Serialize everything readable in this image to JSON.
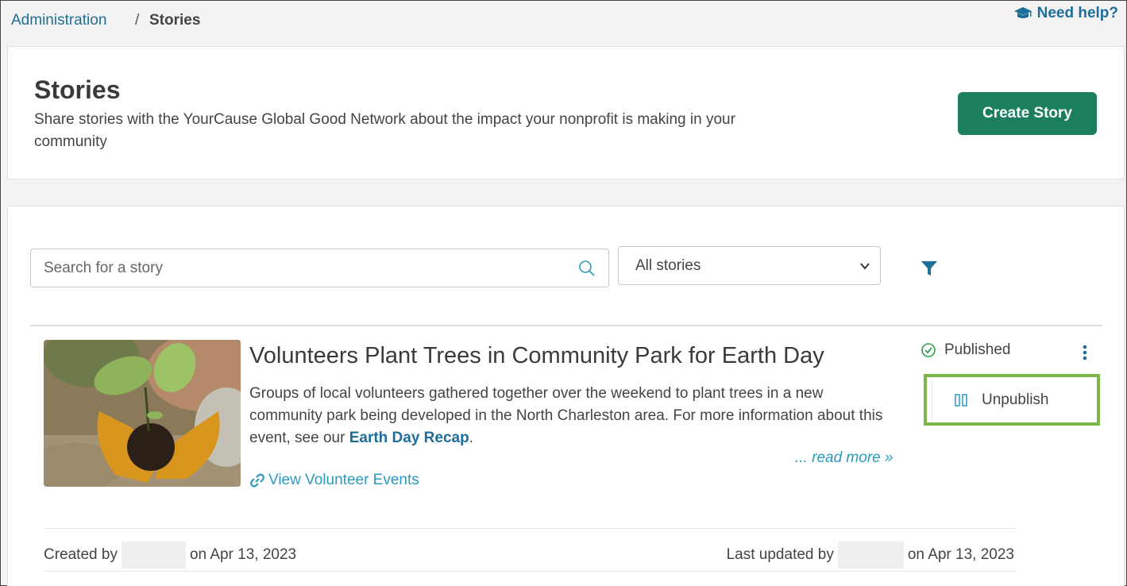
{
  "breadcrumb": {
    "parent": "Administration",
    "separator": "/",
    "current": "Stories"
  },
  "help": {
    "label": "Need help?",
    "icon": "graduation-cap-icon"
  },
  "header": {
    "title": "Stories",
    "description": "Share stories with the YourCause Global Good Network about the impact your nonprofit is making in your community",
    "create_button": "Create Story"
  },
  "toolbar": {
    "search_placeholder": "Search for a story",
    "filter_select_value": "All stories"
  },
  "story": {
    "title": "Volunteers Plant Trees in Community Park for Earth Day",
    "body_text": "Groups of local volunteers gathered together over the weekend to plant trees in a new community park being developed in the North Charleston area. For more information about this event, see our ",
    "body_link": "Earth Day Recap",
    "body_end": ".",
    "read_more": "... read more »",
    "view_events": "View Volunteer Events",
    "status": "Published",
    "menu_action": "Unpublish",
    "created_prefix": "Created by",
    "created_suffix": "on Apr 13, 2023",
    "updated_prefix": "Last updated by",
    "updated_suffix": "on Apr 13, 2023"
  },
  "colors": {
    "primary_green": "#1a7f5a",
    "link_blue": "#1d6e9b",
    "highlight_green": "#7ab648"
  }
}
